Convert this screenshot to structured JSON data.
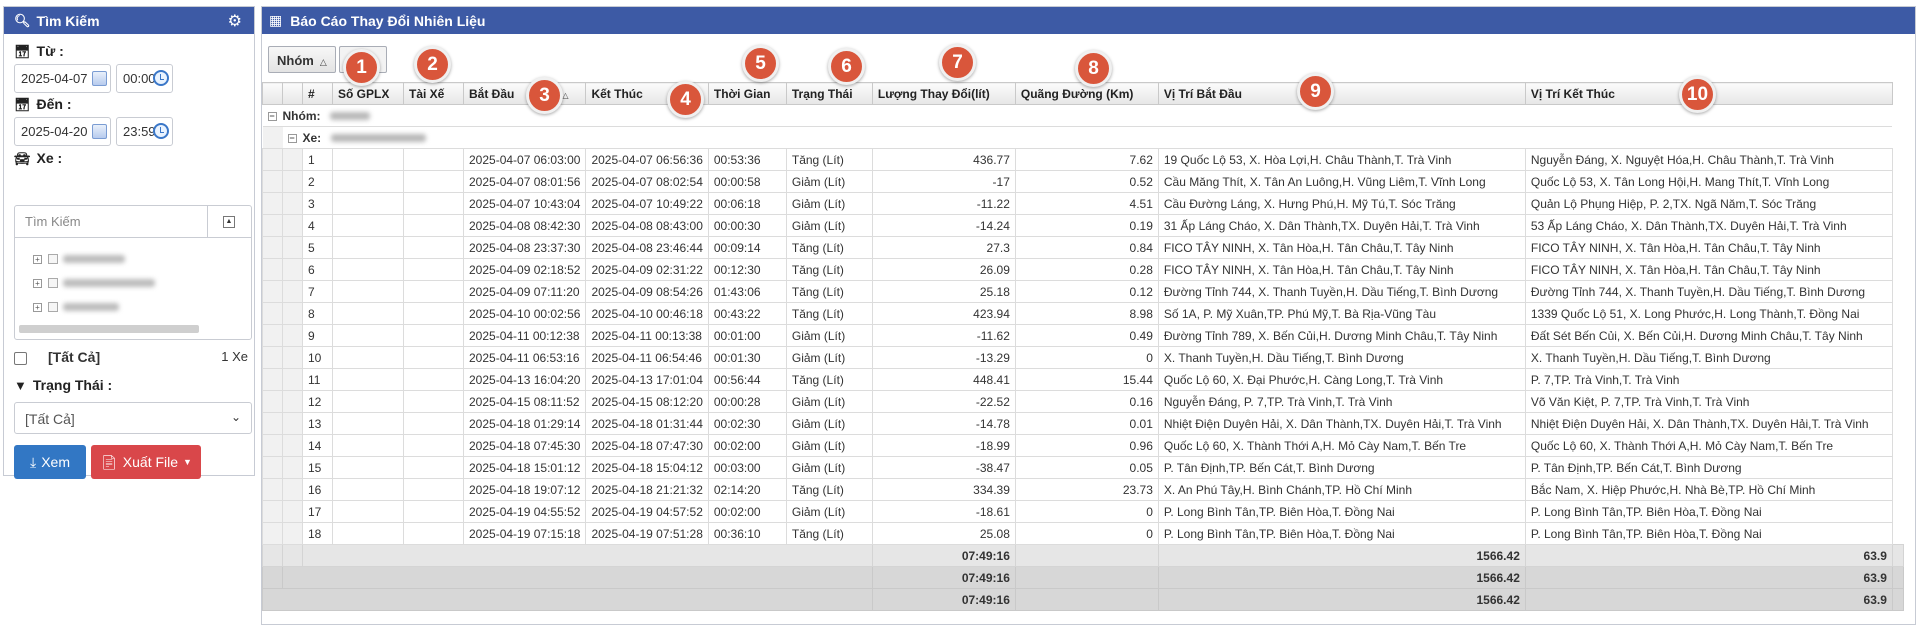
{
  "search": {
    "title": "Tìm Kiếm",
    "from_label": "Từ :",
    "from_date": "2025-04-07",
    "from_time": "00:00",
    "to_label": "Đến :",
    "to_date": "2025-04-20",
    "to_time": "23:59",
    "vehicle_label": "Xe :",
    "vehicle_search_placeholder": "Tìm Kiếm",
    "all_label": "[Tất Cả]",
    "vehicle_count": "1 Xe",
    "status_label": "Trạng Thái :",
    "status_value": "[Tất Cả]",
    "view_button": "Xem",
    "export_button": "Xuất File"
  },
  "report": {
    "title": "Báo Cáo Thay Đổi Nhiên Liệu",
    "group_chip": "Nhóm",
    "group_row_label": "Nhóm:",
    "vehicle_row_label": "Xe:",
    "columns": [
      "#",
      "Số GPLX",
      "Tài Xế",
      "Bắt Đầu",
      "Kết Thúc",
      "Thời Gian",
      "Trạng Thái",
      "Lượng Thay Đổi(lít)",
      "Quãng Đường (Km)",
      "Vị Trí Bắt Đầu",
      "Vị Trí Kết Thúc"
    ],
    "rows": [
      [
        "1",
        "",
        "",
        "2025-04-07 06:03:00",
        "2025-04-07 06:56:36",
        "00:53:36",
        "Tăng (Lít)",
        "436.77",
        "7.62",
        "19 Quốc Lộ 53, X. Hòa Lợi,H. Châu Thành,T. Trà Vinh",
        "Nguyễn Đáng, X. Nguyệt Hóa,H. Châu Thành,T. Trà Vinh"
      ],
      [
        "2",
        "",
        "",
        "2025-04-07 08:01:56",
        "2025-04-07 08:02:54",
        "00:00:58",
        "Giảm (Lít)",
        "-17",
        "0.52",
        "Cầu Măng Thít, X. Tân An Luông,H. Vũng Liêm,T. Vĩnh Long",
        "Quốc Lộ 53, X. Tân Long Hội,H. Mang Thít,T. Vĩnh Long"
      ],
      [
        "3",
        "",
        "",
        "2025-04-07 10:43:04",
        "2025-04-07 10:49:22",
        "00:06:18",
        "Giảm (Lít)",
        "-11.22",
        "4.51",
        "Cầu Đường Láng, X. Hưng Phú,H. Mỹ Tú,T. Sóc Trăng",
        "Quản Lộ Phụng Hiệp, P. 2,TX. Ngã Năm,T. Sóc Trăng"
      ],
      [
        "4",
        "",
        "",
        "2025-04-08 08:42:30",
        "2025-04-08 08:43:00",
        "00:00:30",
        "Giảm (Lít)",
        "-14.24",
        "0.19",
        "31 Ấp Láng Cháo, X. Dân Thành,TX. Duyên Hải,T. Trà Vinh",
        "53 Ấp Láng Cháo, X. Dân Thành,TX. Duyên Hải,T. Trà Vinh"
      ],
      [
        "5",
        "",
        "",
        "2025-04-08 23:37:30",
        "2025-04-08 23:46:44",
        "00:09:14",
        "Tăng (Lít)",
        "27.3",
        "0.84",
        "FICO TÂY NINH, X. Tân Hòa,H. Tân Châu,T. Tây Ninh",
        "FICO TÂY NINH, X. Tân Hòa,H. Tân Châu,T. Tây Ninh"
      ],
      [
        "6",
        "",
        "",
        "2025-04-09 02:18:52",
        "2025-04-09 02:31:22",
        "00:12:30",
        "Tăng (Lít)",
        "26.09",
        "0.28",
        "FICO TÂY NINH, X. Tân Hòa,H. Tân Châu,T. Tây Ninh",
        "FICO TÂY NINH, X. Tân Hòa,H. Tân Châu,T. Tây Ninh"
      ],
      [
        "7",
        "",
        "",
        "2025-04-09 07:11:20",
        "2025-04-09 08:54:26",
        "01:43:06",
        "Tăng (Lít)",
        "25.18",
        "0.12",
        "Đường Tỉnh 744, X. Thanh Tuyền,H. Dầu Tiếng,T. Bình Dương",
        "Đường Tỉnh 744, X. Thanh Tuyền,H. Dầu Tiếng,T. Bình Dương"
      ],
      [
        "8",
        "",
        "",
        "2025-04-10 00:02:56",
        "2025-04-10 00:46:18",
        "00:43:22",
        "Tăng (Lít)",
        "423.94",
        "8.98",
        "Số 1A, P. Mỹ Xuân,TP. Phú Mỹ,T. Bà Rịa-Vũng Tàu",
        "1339 Quốc Lộ 51, X. Long Phước,H. Long Thành,T. Đồng Nai"
      ],
      [
        "9",
        "",
        "",
        "2025-04-11 00:12:38",
        "2025-04-11 00:13:38",
        "00:01:00",
        "Giảm (Lít)",
        "-11.62",
        "0.49",
        "Đường Tỉnh 789, X. Bến Củi,H. Dương Minh Châu,T. Tây Ninh",
        "Đất Sét Bến Củi, X. Bến Củi,H. Dương Minh Châu,T. Tây Ninh"
      ],
      [
        "10",
        "",
        "",
        "2025-04-11 06:53:16",
        "2025-04-11 06:54:46",
        "00:01:30",
        "Giảm (Lít)",
        "-13.29",
        "0",
        "X. Thanh Tuyền,H. Dầu Tiếng,T. Bình Dương",
        "X. Thanh Tuyền,H. Dầu Tiếng,T. Bình Dương"
      ],
      [
        "11",
        "",
        "",
        "2025-04-13 16:04:20",
        "2025-04-13 17:01:04",
        "00:56:44",
        "Tăng (Lít)",
        "448.41",
        "15.44",
        "Quốc Lộ 60, X. Đại Phước,H. Càng Long,T. Trà Vinh",
        "P. 7,TP. Trà Vinh,T. Trà Vinh"
      ],
      [
        "12",
        "",
        "",
        "2025-04-15 08:11:52",
        "2025-04-15 08:12:20",
        "00:00:28",
        "Giảm (Lít)",
        "-22.52",
        "0.16",
        "Nguyễn Đáng, P. 7,TP. Trà Vinh,T. Trà Vinh",
        "Võ Văn Kiệt, P. 7,TP. Trà Vinh,T. Trà Vinh"
      ],
      [
        "13",
        "",
        "",
        "2025-04-18 01:29:14",
        "2025-04-18 01:31:44",
        "00:02:30",
        "Giảm (Lít)",
        "-14.78",
        "0.01",
        "Nhiệt Điện Duyên Hải, X. Dân Thành,TX. Duyên Hải,T. Trà Vinh",
        "Nhiệt Điện Duyên Hải, X. Dân Thành,TX. Duyên Hải,T. Trà Vinh"
      ],
      [
        "14",
        "",
        "",
        "2025-04-18 07:45:30",
        "2025-04-18 07:47:30",
        "00:02:00",
        "Giảm (Lít)",
        "-18.99",
        "0.96",
        "Quốc Lộ 60, X. Thành Thới A,H. Mỏ Cày Nam,T. Bến Tre",
        "Quốc Lộ 60, X. Thành Thới A,H. Mỏ Cày Nam,T. Bến Tre"
      ],
      [
        "15",
        "",
        "",
        "2025-04-18 15:01:12",
        "2025-04-18 15:04:12",
        "00:03:00",
        "Giảm (Lít)",
        "-38.47",
        "0.05",
        "P. Tân Định,TP. Bến Cát,T. Bình Dương",
        "P. Tân Định,TP. Bến Cát,T. Bình Dương"
      ],
      [
        "16",
        "",
        "",
        "2025-04-18 19:07:12",
        "2025-04-18 21:21:32",
        "02:14:20",
        "Tăng (Lít)",
        "334.39",
        "23.73",
        "X. An Phú Tây,H. Bình Chánh,TP. Hồ Chí Minh",
        "Bắc Nam, X. Hiệp Phước,H. Nhà Bè,TP. Hồ Chí Minh"
      ],
      [
        "17",
        "",
        "",
        "2025-04-19 04:55:52",
        "2025-04-19 04:57:52",
        "00:02:00",
        "Giảm (Lít)",
        "-18.61",
        "0",
        "P. Long Bình Tân,TP. Biên Hòa,T. Đồng Nai",
        "P. Long Bình Tân,TP. Biên Hòa,T. Đồng Nai"
      ],
      [
        "18",
        "",
        "",
        "2025-04-19 07:15:18",
        "2025-04-19 07:51:28",
        "00:36:10",
        "Tăng (Lít)",
        "25.08",
        "0",
        "P. Long Bình Tân,TP. Biên Hòa,T. Đồng Nai",
        "P. Long Bình Tân,TP. Biên Hòa,T. Đồng Nai"
      ]
    ],
    "summaries": [
      {
        "time": "07:49:16",
        "amount": "1566.42",
        "distance": "63.9"
      },
      {
        "time": "07:49:16",
        "amount": "1566.42",
        "distance": "63.9"
      },
      {
        "time": "07:49:16",
        "amount": "1566.42",
        "distance": "63.9"
      }
    ]
  },
  "markers": [
    "1",
    "2",
    "3",
    "4",
    "5",
    "6",
    "7",
    "8",
    "9",
    "10"
  ],
  "colors": {
    "header_blue": "#3d5aa5",
    "view_button": "#3277c4",
    "export_button": "#d9474a",
    "marker_red": "#d9563b"
  }
}
